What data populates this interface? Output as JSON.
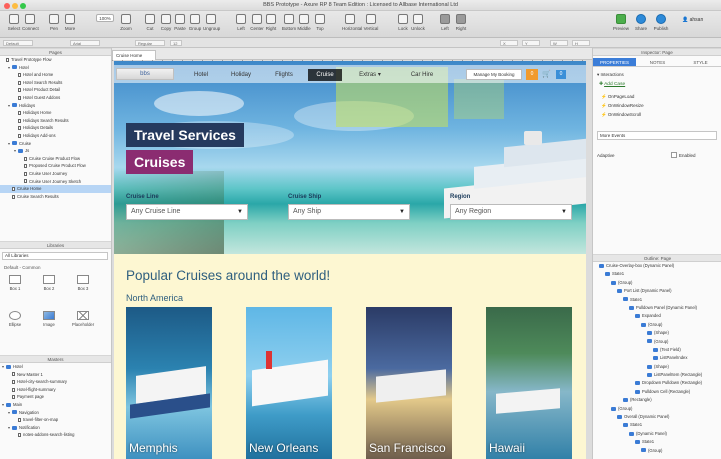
{
  "window": {
    "title": "BBS Prototype - Axure RP 8 Team Edition : Licensed to Allbase International Ltd"
  },
  "toolbar": {
    "items": [
      "Select",
      "Connect",
      "Pen",
      "More",
      "100%",
      "Zoom",
      "Cut",
      "Copy",
      "Paste",
      "Group",
      "Ungroup",
      "Left",
      "Center",
      "Right",
      "Bottom",
      "Middle",
      "Top",
      "Horizontal",
      "Vertical",
      "Lock",
      "Unlock",
      "Left",
      "Right"
    ],
    "zoom_value": "100%",
    "preview": "Preview",
    "share": "Share",
    "publish": "Publish",
    "user": "ahsan"
  },
  "stylebar": {
    "style": "Default",
    "font": "Arial",
    "weight": "Regular",
    "size": "12",
    "x": "X",
    "y": "Y",
    "w": "W",
    "h": "H"
  },
  "pages": {
    "header": "Pages",
    "items": [
      {
        "label": "Travel Prototype Flow",
        "indent": 0,
        "type": "page"
      },
      {
        "label": "Hotel",
        "indent": 1,
        "type": "folder"
      },
      {
        "label": "Hotel and Home",
        "indent": 2,
        "type": "page"
      },
      {
        "label": "Hotel Search Results",
        "indent": 2,
        "type": "page"
      },
      {
        "label": "Hotel Product Detail",
        "indent": 2,
        "type": "page"
      },
      {
        "label": "Hotel Guest Addons",
        "indent": 2,
        "type": "page"
      },
      {
        "label": "Holidays",
        "indent": 1,
        "type": "folder"
      },
      {
        "label": "Holidays Home",
        "indent": 2,
        "type": "page"
      },
      {
        "label": "Holidays Search Results",
        "indent": 2,
        "type": "page"
      },
      {
        "label": "Holidays Details",
        "indent": 2,
        "type": "page"
      },
      {
        "label": "Holidays Add-ons",
        "indent": 2,
        "type": "page"
      },
      {
        "label": "Cruise",
        "indent": 1,
        "type": "folder"
      },
      {
        "label": "Js",
        "indent": 2,
        "type": "folder"
      },
      {
        "label": "Cruise Cruise Product Flow",
        "indent": 3,
        "type": "page"
      },
      {
        "label": "Proposed Cruise Product Flow",
        "indent": 3,
        "type": "page"
      },
      {
        "label": "Cruise User Journey",
        "indent": 3,
        "type": "page"
      },
      {
        "label": "Cruise User Journey Sketch",
        "indent": 3,
        "type": "page"
      },
      {
        "label": "Cruise Home",
        "indent": 1,
        "type": "page",
        "selected": true
      },
      {
        "label": "Cruise Search Results",
        "indent": 1,
        "type": "page"
      }
    ]
  },
  "libraries": {
    "header": "Libraries",
    "dropdown": "All Libraries",
    "group": "Default - Common",
    "items": [
      "Box 1",
      "Box 2",
      "Box 3",
      "Ellipse",
      "Image",
      "Placeholder"
    ]
  },
  "masters": {
    "header": "Masters",
    "items": [
      {
        "label": "Hotel",
        "indent": 0,
        "type": "folder"
      },
      {
        "label": "New Master 1",
        "indent": 1,
        "type": "page"
      },
      {
        "label": "Hotel-city-search-summary",
        "indent": 1,
        "type": "page"
      },
      {
        "label": "Hotel-flight-summary",
        "indent": 1,
        "type": "page"
      },
      {
        "label": "Payment page",
        "indent": 1,
        "type": "page"
      },
      {
        "label": "Main",
        "indent": 0,
        "type": "folder"
      },
      {
        "label": "Navigation",
        "indent": 1,
        "type": "folder"
      },
      {
        "label": "travel-filter-on-map",
        "indent": 2,
        "type": "page"
      },
      {
        "label": "Notification",
        "indent": 1,
        "type": "folder"
      },
      {
        "label": "notes-addons-search-listing",
        "indent": 2,
        "type": "page"
      }
    ]
  },
  "canvas": {
    "tab_label": "Cruise Home",
    "nav": {
      "logo": "bbs",
      "items": [
        "Hotel",
        "Holiday",
        "Flights",
        "Cruise",
        "Extras ▾",
        "Car Hire"
      ],
      "active_index": 3,
      "manage": "Manage My Booking",
      "cart_count": "0",
      "badge": "0"
    },
    "hero": {
      "title1": "Travel Services",
      "title2": "Cruises",
      "filters": [
        {
          "label": "Cruise Line",
          "placeholder": "Any Cruise Line"
        },
        {
          "label": "Cruise Ship",
          "placeholder": "Any Ship"
        },
        {
          "label": "Region",
          "placeholder": "Any Region"
        }
      ]
    },
    "section": {
      "heading": "Popular Cruises around the world!",
      "subheading": "North America",
      "cards": [
        "Memphis",
        "New Orleans",
        "San Francisco",
        "Hawaii"
      ]
    }
  },
  "inspector": {
    "header": "Inspector: Page",
    "tabs": [
      "PROPERTIES",
      "NOTES",
      "STYLE"
    ],
    "active_tab": 0,
    "interactions_label": "Interactions",
    "add_case": "Add Case",
    "events": [
      "OnPageLoad",
      "OnWindowResize",
      "OnWindowScroll"
    ],
    "more_events": "More Events",
    "adaptive": "Adaptive",
    "enabled": "Enabled"
  },
  "outline": {
    "header": "Outline: Page",
    "items": [
      {
        "label": "Cruise-Overlay-box (Dynamic Panel)",
        "indent": 0
      },
      {
        "label": "State1",
        "indent": 1
      },
      {
        "label": "(Group)",
        "indent": 2
      },
      {
        "label": "Port List (Dynamic Panel)",
        "indent": 3
      },
      {
        "label": "State1",
        "indent": 4
      },
      {
        "label": "Pulldown Panel (Dynamic Panel)",
        "indent": 5
      },
      {
        "label": "Expanded",
        "indent": 6
      },
      {
        "label": "(Group)",
        "indent": 7
      },
      {
        "label": "(Shape)",
        "indent": 8
      },
      {
        "label": "(Group)",
        "indent": 8
      },
      {
        "label": "(Text Field)",
        "indent": 9
      },
      {
        "label": "ListPanelIndex",
        "indent": 9
      },
      {
        "label": "(Shape)",
        "indent": 8
      },
      {
        "label": "ListPanelItem (Rectangle)",
        "indent": 8
      },
      {
        "label": "Dropdown Pulldown (Rectangle)",
        "indent": 6
      },
      {
        "label": "Pulldown Cell (Rectangle)",
        "indent": 6
      },
      {
        "label": "(Rectangle)",
        "indent": 4
      },
      {
        "label": "(Group)",
        "indent": 2
      },
      {
        "label": "Overall (Dynamic Panel)",
        "indent": 3
      },
      {
        "label": "State1",
        "indent": 4
      },
      {
        "label": "(Dynamic Panel)",
        "indent": 5
      },
      {
        "label": "State1",
        "indent": 6
      },
      {
        "label": "(Group)",
        "indent": 7
      }
    ]
  }
}
